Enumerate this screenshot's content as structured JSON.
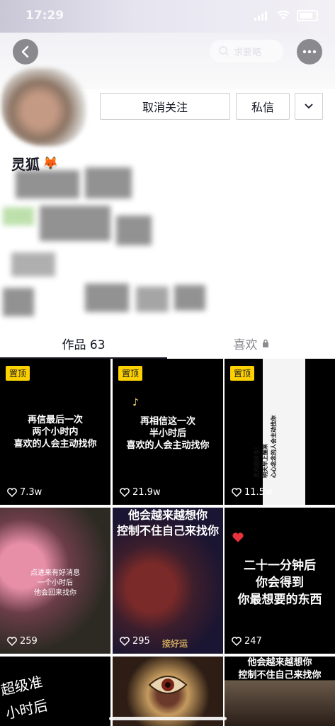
{
  "status_bar": {
    "time": "17:29"
  },
  "header": {
    "search_placeholder": "求要略"
  },
  "profile": {
    "username": "灵狐",
    "username_emoji": "🦊",
    "unfollow_label": "取消关注",
    "message_label": "私信"
  },
  "tabs": {
    "works_label": "作品 63",
    "likes_label": "喜欢"
  },
  "pin_label": "置顶",
  "videos": [
    {
      "caption": "再信最后一次\n两个小时内\n喜欢的人会主动找你",
      "likes": "7.3w",
      "pinned": true
    },
    {
      "caption": "再相信这一次\n半小时后\n喜欢的人会主动找你",
      "likes": "21.9w",
      "pinned": true
    },
    {
      "caption": "真的超级准！\n明天早上醒来\n心心念念的人会主动找你",
      "likes": "11.5w",
      "pinned": true
    },
    {
      "caption": "点进来有好消息\n一个小时后\n他会回来找你",
      "likes": "259",
      "pinned": false
    },
    {
      "caption": "他会越来越想你\n控制不住自己来找你",
      "likes": "295",
      "pinned": false,
      "footer": "接好运"
    },
    {
      "caption": "二十一分钟后\n你会得到\n你最想要的东西",
      "likes": "247",
      "pinned": false
    },
    {
      "caption": "超级准\n小时后",
      "likes": "",
      "pinned": false
    },
    {
      "caption": "",
      "likes": "",
      "pinned": false
    },
    {
      "caption": "他会越来越想你\n控制不住自己来找你",
      "likes": "",
      "pinned": false
    }
  ]
}
